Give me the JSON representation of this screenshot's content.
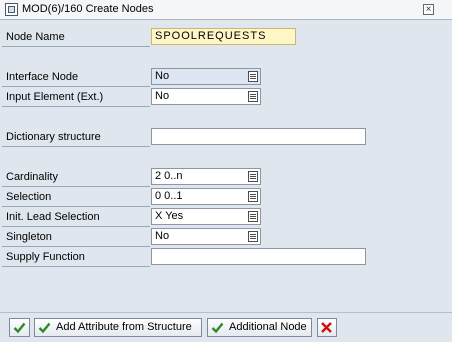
{
  "window": {
    "title": "MOD(6)/160 Create Nodes",
    "close_symbol": "×"
  },
  "form": {
    "node_name": {
      "label": "Node Name",
      "value": "SPOOLREQUESTS"
    },
    "interface_node": {
      "label": "Interface Node",
      "value": "No"
    },
    "input_element": {
      "label": "Input Element (Ext.)",
      "value": "No"
    },
    "dictionary_structure": {
      "label": "Dictionary structure",
      "value": ""
    },
    "cardinality": {
      "label": "Cardinality",
      "value": "2 0..n"
    },
    "selection": {
      "label": "Selection",
      "value": "0 0..1"
    },
    "init_lead_selection": {
      "label": "Init. Lead Selection",
      "value": "X Yes"
    },
    "singleton": {
      "label": "Singleton",
      "value": "No"
    },
    "supply_function": {
      "label": "Supply Function",
      "value": ""
    }
  },
  "footer": {
    "add_attribute_label": "Add Attribute from Structure",
    "additional_node_label": "Additional Node",
    "accept_color": "#2e8b22",
    "cancel_color": "#d01010"
  },
  "icons": {
    "f4_help": "value-help-icon",
    "accept": "checkmark-icon",
    "cancel": "cancel-x-icon"
  }
}
